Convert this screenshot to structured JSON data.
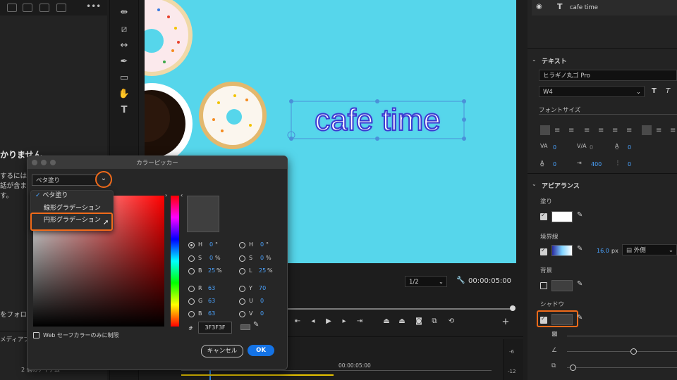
{
  "left_panel": {
    "partial_heading": "かりません",
    "partial_lines": [
      "するには",
      "話が含ま",
      "す。"
    ],
    "follow_text": "をフォロ",
    "media_text": "メディアブ",
    "items_count": "2 個のアイテム"
  },
  "monitor": {
    "overlay_text": "cafe time",
    "zoom_select": "1/2",
    "timecode": "00:00:05:00"
  },
  "timeline": {
    "ruler_time": "00:00:05:00",
    "meter_labels": [
      "-6",
      "-12"
    ]
  },
  "color_picker": {
    "title": "カラーピッカー",
    "fill_type": "ベタ塗り",
    "menu": {
      "items": [
        "ベタ塗り",
        "線形グラデーション",
        "円形グラデーション"
      ],
      "selected": "ベタ塗り",
      "hovered": "円形グラデーション"
    },
    "hsb": [
      {
        "label": "H",
        "value": "0",
        "unit": "°",
        "selected": true
      },
      {
        "label": "S",
        "value": "0",
        "unit": "%",
        "selected": false
      },
      {
        "label": "B",
        "value": "25",
        "unit": "%",
        "selected": false
      }
    ],
    "hsl": [
      {
        "label": "H",
        "value": "0",
        "unit": "°"
      },
      {
        "label": "S",
        "value": "0",
        "unit": "%"
      },
      {
        "label": "L",
        "value": "25",
        "unit": "%"
      }
    ],
    "rgb": [
      {
        "label": "R",
        "value": "63"
      },
      {
        "label": "G",
        "value": "63"
      },
      {
        "label": "B",
        "value": "63"
      }
    ],
    "yuv": [
      {
        "label": "Y",
        "value": "70"
      },
      {
        "label": "U",
        "value": "0"
      },
      {
        "label": "V",
        "value": "0"
      }
    ],
    "hex_label": "#",
    "hex": "3F3F3F",
    "web_safe_label": "Web セーフカラーのみに制限",
    "cancel_label": "キャンセル",
    "ok_label": "OK",
    "current_color": "#3f3f3f",
    "hue_color": "#ff0000"
  },
  "essential_graphics": {
    "layer_name": "cafe time",
    "text_section": "テキスト",
    "font_family": "ヒラギノ丸ゴ Pro",
    "font_weight": "W4",
    "font_size_label": "フォントサイズ",
    "tracking_values": [
      "0",
      "0",
      "0"
    ],
    "line_values": [
      "0",
      "400",
      "0"
    ],
    "appearance_section": "アピアランス",
    "fill_label": "塗り",
    "fill_color": "#ffffff",
    "stroke_label": "境界線",
    "stroke_width": "16.0",
    "stroke_unit": "px",
    "stroke_type": "外側",
    "background_label": "背景",
    "background_color": "#3f3f3f",
    "shadow_label": "シャドウ",
    "shadow_color": "#3f3f3f",
    "shadow_checked": true,
    "fill_checked": true,
    "stroke_checked": true,
    "background_checked": false
  },
  "colors": {
    "accent": "#1473e6",
    "highlight": "#f06a1a",
    "monitor_bg": "#56d6eb"
  }
}
